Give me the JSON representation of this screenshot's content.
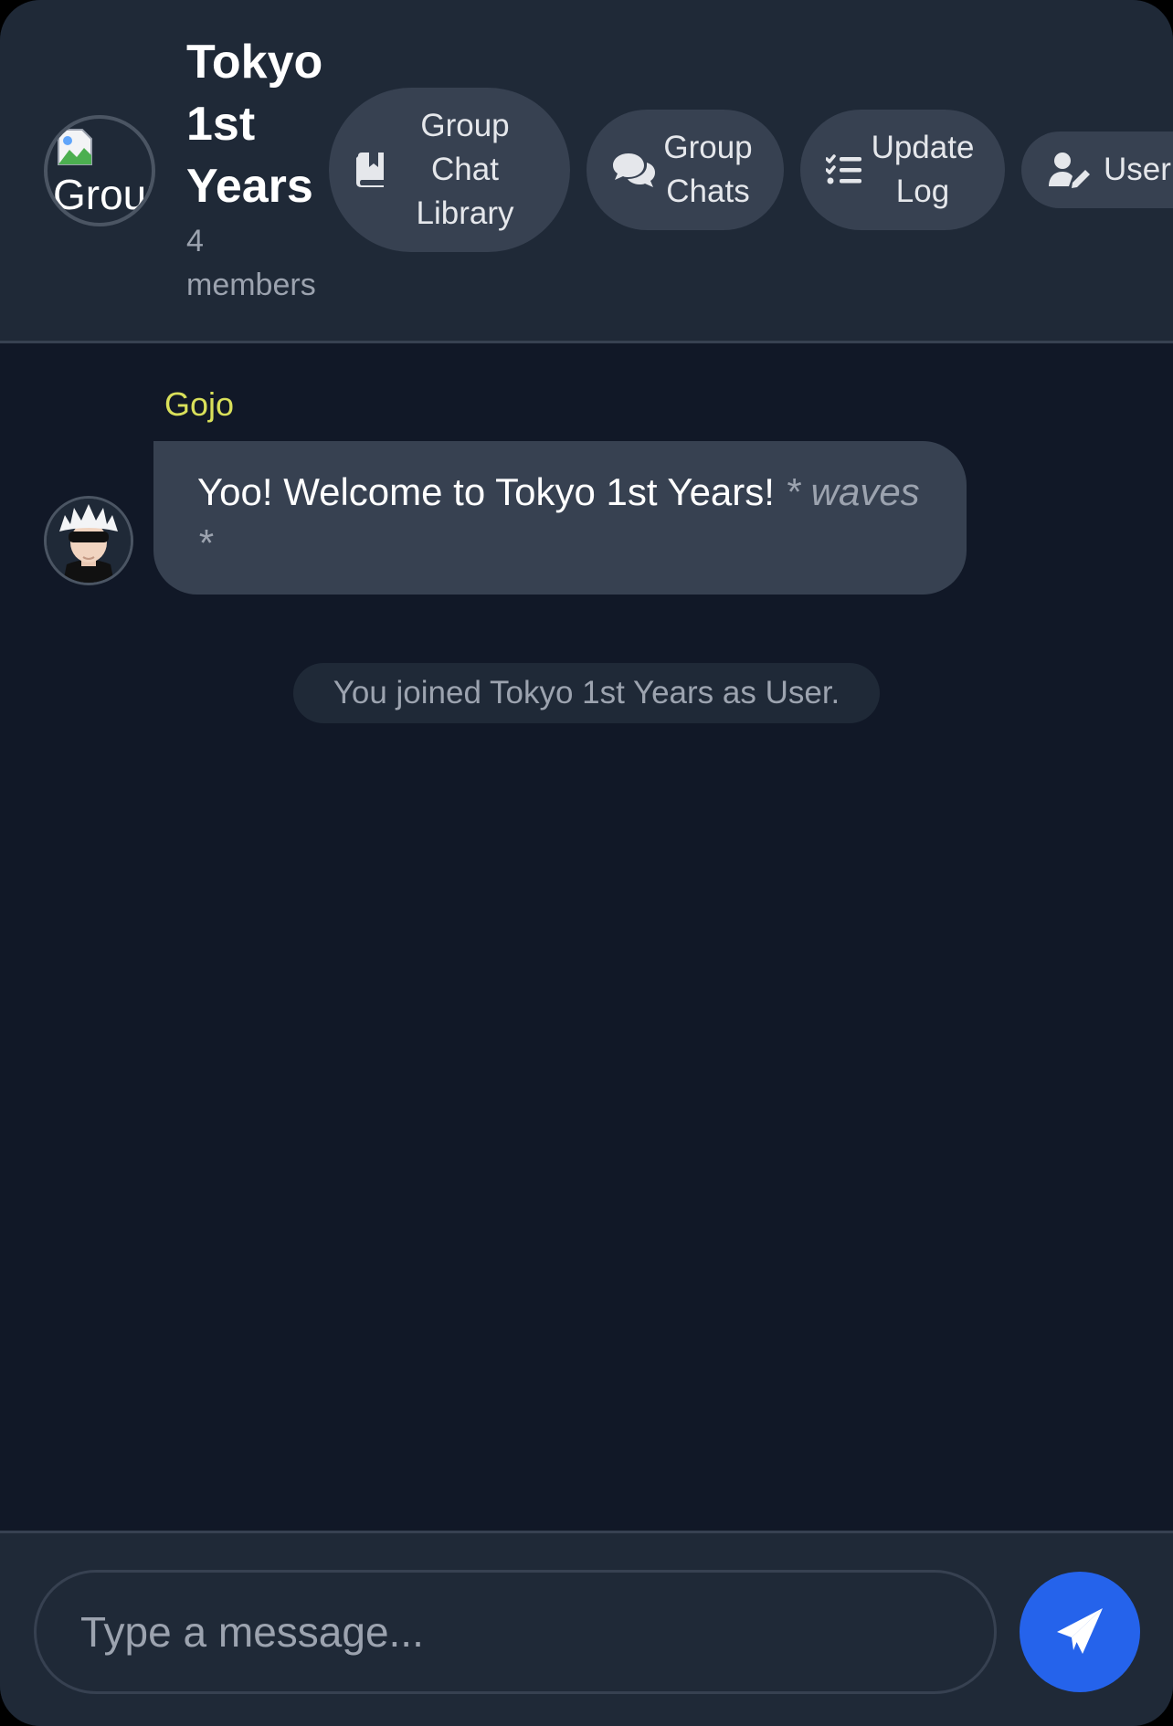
{
  "header": {
    "group_avatar_alt": "Group",
    "title": "Tokyo 1st Years",
    "members": "4 members",
    "nav": {
      "library": "Group Chat Library",
      "chats": "Group Chats",
      "update_log": "Update Log",
      "user": "User"
    }
  },
  "messages": [
    {
      "sender": "Gojo",
      "sender_color": "#d9e05a",
      "text": "Yoo! Welcome to Tokyo 1st Years!",
      "action": "* waves *"
    }
  ],
  "system_message": "You joined Tokyo 1st Years as User.",
  "composer": {
    "placeholder": "Type a message..."
  },
  "icons": {
    "library": "book-bookmark-icon",
    "chats": "comments-icon",
    "update_log": "list-check-icon",
    "user": "user-pen-icon",
    "send": "paper-plane-icon"
  },
  "colors": {
    "background": "#111827",
    "header": "#1f2937",
    "bubble": "#374151",
    "accent": "#2563eb"
  }
}
